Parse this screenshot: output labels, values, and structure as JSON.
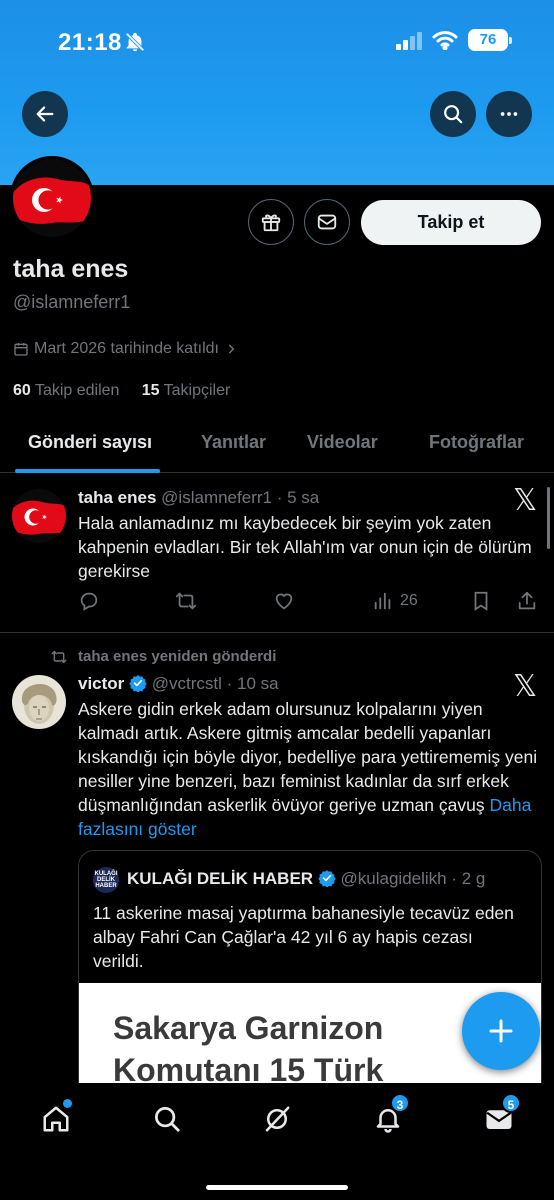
{
  "status_bar": {
    "time": "21:18",
    "battery": "76"
  },
  "profile": {
    "name": "taha enes",
    "handle": "@islamneferr1",
    "joined": "Mart 2026 tarihinde katıldı",
    "following_count": "60",
    "following_label": "Takip edilen",
    "followers_count": "15",
    "followers_label": "Takipçiler",
    "follow_button": "Takip et"
  },
  "tabs": [
    {
      "label": "Gönderi sayısı",
      "active": true
    },
    {
      "label": "Yanıtlar"
    },
    {
      "label": "Videolar"
    },
    {
      "label": "Fotoğraflar"
    }
  ],
  "tweets": [
    {
      "name": "taha enes",
      "handle": "@islamneferr1",
      "time": "· 5 sa",
      "text": "Hala anlamadınız mı kaybedecek bir şeyim yok zaten kahpenin evladları. Bir tek Allah'ım var onun için de ölürüm gerekirse",
      "views": "26"
    },
    {
      "retweet_label": "taha enes yeniden gönderdi",
      "name": "victor",
      "handle": "@vctrcstl",
      "time": "· 10 sa",
      "text": "Askere gidin erkek adam olursunuz kolpalarını yiyen kalmadı artık. Askere gitmiş amcalar bedelli yapanları kıskandığı için böyle diyor, bedelliye para yettirememiş yeni nesiller yine benzeri, bazı feminist kadınlar da sırf erkek düşmanlığından askerlik övüyor geriye uzman çavuş",
      "show_more": "Daha fazlasını göster",
      "quote": {
        "avatar_text": "KULAĞI DELİK HABER",
        "name": "KULAĞI DELİK HABER",
        "handle": "@kulagidelikh",
        "time": "· 2 g",
        "text": "11 askerine masaj yaptırma bahanesiyle tecavüz eden albay Fahri Can Çağlar'a 42 yıl 6 ay hapis cezası verildi.",
        "image_line1": "Sakarya Garnizon",
        "image_line2": "Komutanı 15 Türk"
      }
    }
  ],
  "bottom_nav": {
    "notifications_badge": "3",
    "messages_badge": "5"
  },
  "colors": {
    "accent": "#1d9bf0",
    "background": "#000000",
    "text": "#e7e9ea",
    "muted": "#71767b",
    "verified": "#1d9bf0"
  }
}
